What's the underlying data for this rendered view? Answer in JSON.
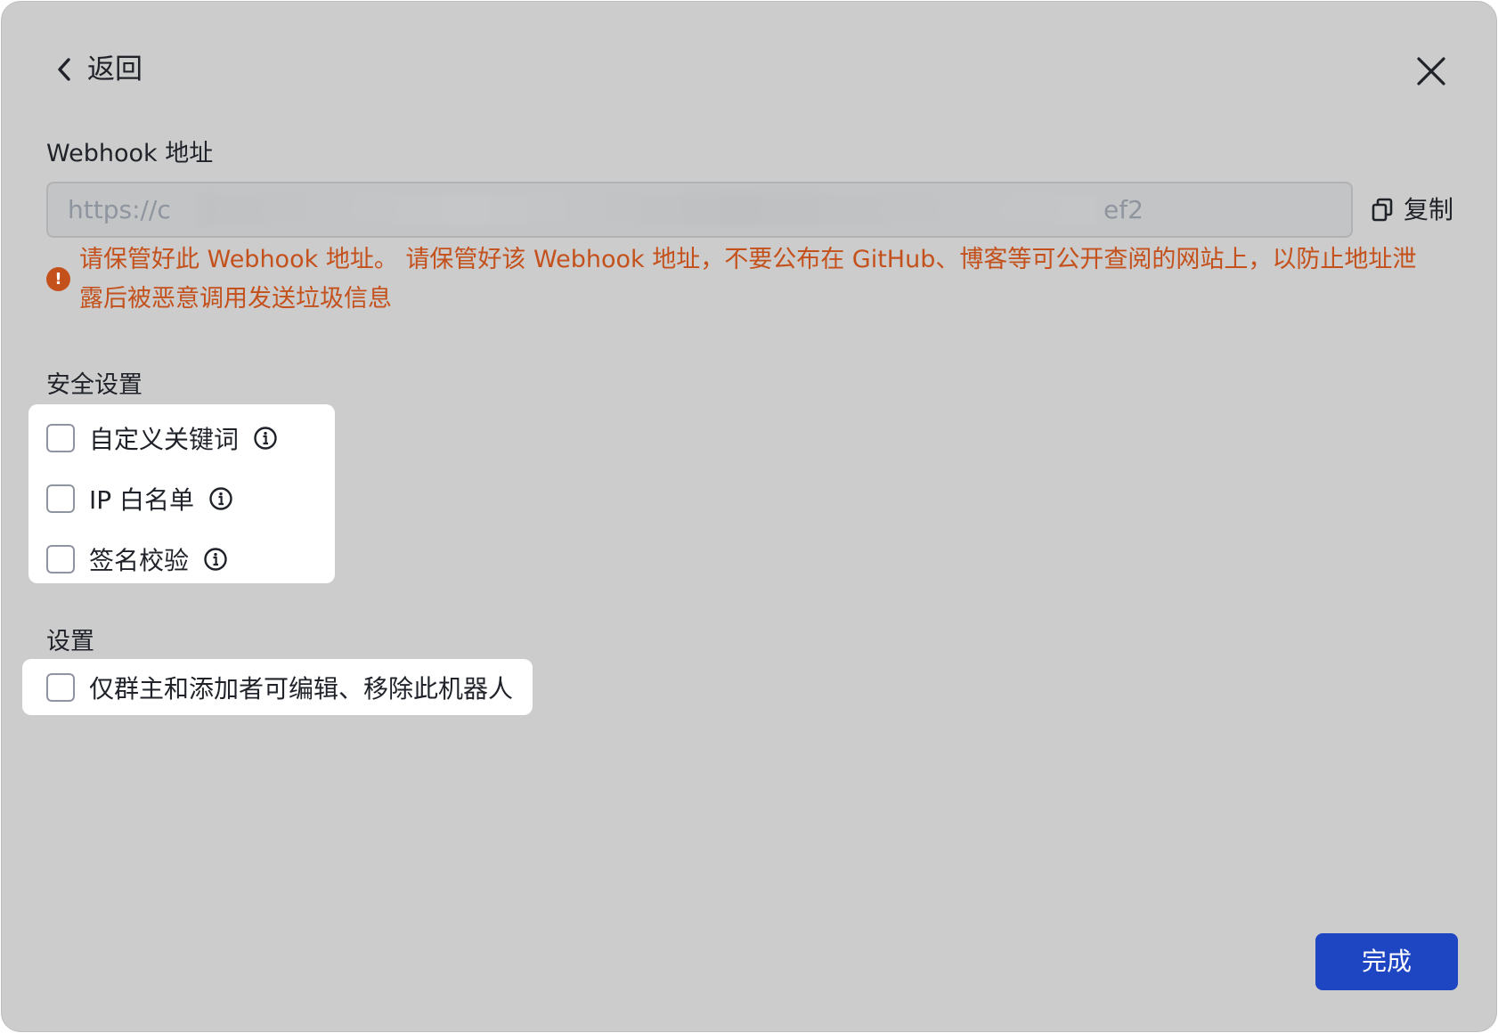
{
  "header": {
    "back_label": "返回"
  },
  "webhook": {
    "title": "Webhook 地址",
    "url_prefix": "https://c",
    "url_suffix": "ef2",
    "copy_label": "复制",
    "warning_line1": "请保管好此 Webhook 地址。 请保管好该 Webhook 地址，不要公布在 GitHub、博客等可公开查阅的网站上，以防止地址泄",
    "warning_line2": "露后被恶意调用发送垃圾信息"
  },
  "security": {
    "title": "安全设置",
    "options": [
      {
        "label": "自定义关键词",
        "checked": false
      },
      {
        "label": "IP 白名单",
        "checked": false
      },
      {
        "label": "签名校验",
        "checked": false
      }
    ]
  },
  "settings": {
    "title": "设置",
    "options": [
      {
        "label": "仅群主和添加者可编辑、移除此机器人",
        "checked": false
      }
    ]
  },
  "footer": {
    "done_label": "完成"
  },
  "colors": {
    "dialog_bg": "#cccccc",
    "warning": "#c4511c",
    "primary": "#1e46c2"
  }
}
